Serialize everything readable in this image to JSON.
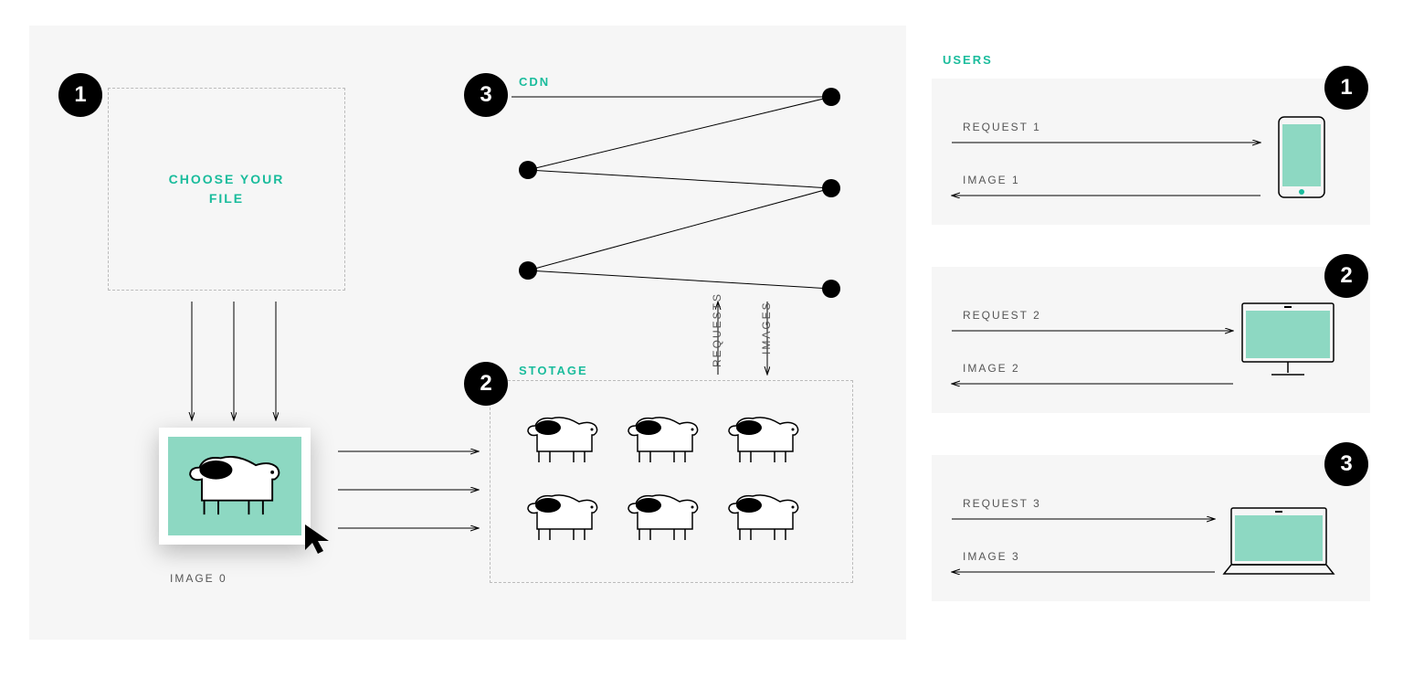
{
  "left": {
    "choose_label": "CHOOSE YOUR\nFILE",
    "image_caption": "IMAGE 0",
    "storage_label": "STOTAGE",
    "cdn_label": "CDN",
    "requests_label": "REQUESTS",
    "images_label": "IMAGES",
    "badges": {
      "one": "1",
      "two": "2",
      "three": "3"
    }
  },
  "right": {
    "users_label": "USERS",
    "cards": [
      {
        "badge": "1",
        "req": "REQUEST 1",
        "img": "IMAGE 1"
      },
      {
        "badge": "2",
        "req": "REQUEST 2",
        "img": "IMAGE 2"
      },
      {
        "badge": "3",
        "req": "REQUEST 3",
        "img": "IMAGE 3"
      }
    ]
  },
  "colors": {
    "green": "#1abc9c",
    "mint": "#8dd8c2",
    "bg": "#f6f6f6"
  }
}
